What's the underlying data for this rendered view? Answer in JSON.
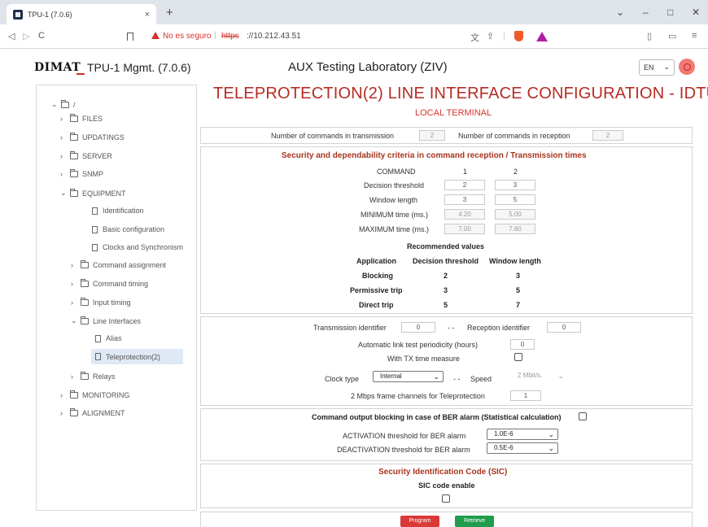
{
  "browser": {
    "tab_title": "TPU-1 (7.0.6)",
    "tab_close": "×",
    "new_tab": "+",
    "insecure_label": "No es seguro",
    "url_scheme": "https",
    "url_host": "://10.212.43.51"
  },
  "header": {
    "logo": "DIMAT",
    "app_title": "TPU-1 Mgmt. (7.0.6)",
    "lab_title": "AUX Testing Laboratory (ZIV)",
    "language": "EN"
  },
  "sidebar": {
    "root": "/",
    "items": [
      {
        "label": "FILES"
      },
      {
        "label": "UPDATINGS"
      },
      {
        "label": "SERVER"
      },
      {
        "label": "SNMP"
      },
      {
        "label": "EQUIPMENT"
      },
      {
        "label": "Identification"
      },
      {
        "label": "Basic configuration"
      },
      {
        "label": "Clocks and Synchronism"
      },
      {
        "label": "Command assignment"
      },
      {
        "label": "Command timing"
      },
      {
        "label": "Input timing"
      },
      {
        "label": "Line Interfaces"
      },
      {
        "label": "Alias"
      },
      {
        "label": "Teleprotection(2)"
      },
      {
        "label": "Relays"
      },
      {
        "label": "MONITORING"
      },
      {
        "label": "ALIGNMENT"
      }
    ]
  },
  "page": {
    "title": "TELEPROTECTION(2) LINE INTERFACE CONFIGURATION - IDTU",
    "subtitle": "LOCAL TERMINAL"
  },
  "commands": {
    "tx_label": "Number of commands in transmission",
    "tx_value": "2",
    "rx_label": "Number of commands in reception",
    "rx_value": "2"
  },
  "criteria": {
    "title": "Security and dependability criteria in command reception / Transmission times",
    "command_label": "COMMAND",
    "col1": "1",
    "col2": "2",
    "rows": [
      {
        "label": "Decision threshold",
        "v1": "2",
        "v2": "3"
      },
      {
        "label": "Window length",
        "v1": "3",
        "v2": "5"
      },
      {
        "label": "MINIMUM time (ms.)",
        "v1": "4.20",
        "v2": "5.00"
      },
      {
        "label": "MAXIMUM time (ms.)",
        "v1": "7.00",
        "v2": "7.80"
      }
    ],
    "recommended_title": "Recommended values",
    "rec_headers": [
      "Application",
      "Decision threshold",
      "Window length"
    ],
    "rec_rows": [
      {
        "app": "Blocking",
        "dt": "2",
        "wl": "3"
      },
      {
        "app": "Permissive trip",
        "dt": "3",
        "wl": "5"
      },
      {
        "app": "Direct trip",
        "dt": "5",
        "wl": "7"
      }
    ]
  },
  "link": {
    "tx_id_label": "Transmission identifier",
    "tx_id_value": "0",
    "separator": "- -",
    "rx_id_label": "Reception identifier",
    "rx_id_value": "0",
    "test_period_label": "Automatic link test periodicity (hours)",
    "test_period_value": "0",
    "tx_time_label": "With TX time measure",
    "clock_type_label": "Clock type",
    "clock_type_value": "Internal",
    "speed_label": "Speed",
    "speed_value": "2 Mbit/s.",
    "frame_channels_label": "2 Mbps frame channels for Teleprotection",
    "frame_channels_value": "1"
  },
  "ber": {
    "title": "Command output blocking in case of BER alarm (Statistical calculation)",
    "activation_label": "ACTIVATION threshold for BER alarm",
    "activation_value": "1.0E-6",
    "deactivation_label": "DEACTIVATION threshold for BER alarm",
    "deactivation_value": "0.5E-6"
  },
  "sic": {
    "title": "Security Identification Code (SIC)",
    "enable_label": "SIC code enable"
  },
  "actions": {
    "program_label": "Program",
    "retrieve_label": "Retrieve"
  },
  "colors": {
    "title_red": "#b62c23",
    "section_title": "#a8351e",
    "program_btn": "#d93a37",
    "retrieve_btn": "#1f9d4c"
  }
}
